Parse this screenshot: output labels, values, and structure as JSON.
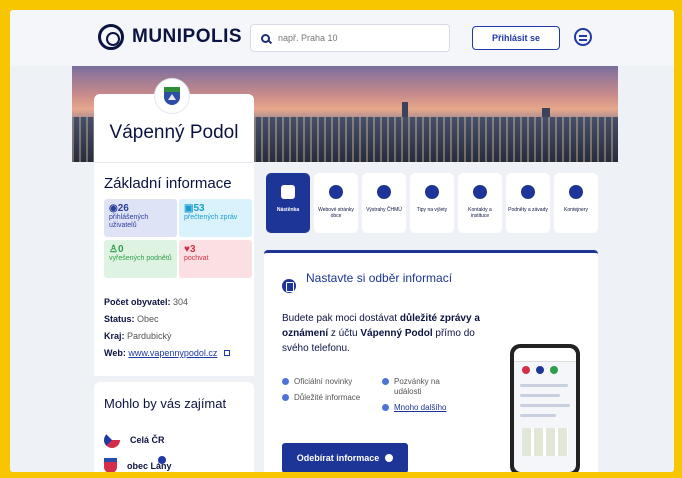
{
  "header": {
    "logo_text": "MUNIPOLIS",
    "search_placeholder": "např. Praha 10",
    "login_label": "Přihlásit se"
  },
  "profile": {
    "town_name": "Vápenný Podol"
  },
  "info": {
    "title": "Základní informace",
    "stats": {
      "users": {
        "value": "26",
        "label": "přihlášených uživatelů"
      },
      "reads": {
        "value": "53",
        "label": "přečtených zpráv"
      },
      "solved": {
        "value": "0",
        "label": "vyřešených podnětů"
      },
      "likes": {
        "value": "3",
        "label": "pochvat"
      }
    },
    "population_label": "Počet obyvatel:",
    "population_value": "304",
    "status_label": "Status:",
    "status_value": "Obec",
    "region_label": "Kraj:",
    "region_value": "Pardubický",
    "web_label": "Web:",
    "web_value": "www.vapennypodol.cz"
  },
  "suggestions": {
    "title": "Mohlo by vás zajímat",
    "items": [
      {
        "label": "Celá ČR"
      },
      {
        "label": "obec Lány"
      }
    ]
  },
  "tabs": [
    {
      "label": "Nástěnka",
      "icon": "board-icon"
    },
    {
      "label": "Webové stránky obce",
      "icon": "info-icon"
    },
    {
      "label": "Výstrahy ČHMÚ",
      "icon": "alert-icon"
    },
    {
      "label": "Tipy na výlety",
      "icon": "compass-icon"
    },
    {
      "label": "Kontakty a instituce",
      "icon": "phone-icon"
    },
    {
      "label": "Podněty a závady",
      "icon": "pin-icon"
    },
    {
      "label": "Kontejnery",
      "icon": "container-icon"
    }
  ],
  "subscribe": {
    "title": "Nastavte si odběr informací",
    "text_before": "Budete pak moci dostávat ",
    "text_bold_1": "důležité zprávy a oznámení",
    "text_middle": " z účtu ",
    "text_bold_2": "Vápenný Podol",
    "text_after": " přímo do svého telefonu.",
    "bullets": [
      "Oficiální novinky",
      "Pozvánky na události",
      "Důležité informace",
      "Mnoho dalšího"
    ],
    "button_label": "Odebírat informace"
  },
  "colors": {
    "brand": "#1c3596",
    "background": "#eef1f6",
    "frame": "#f7c600"
  }
}
